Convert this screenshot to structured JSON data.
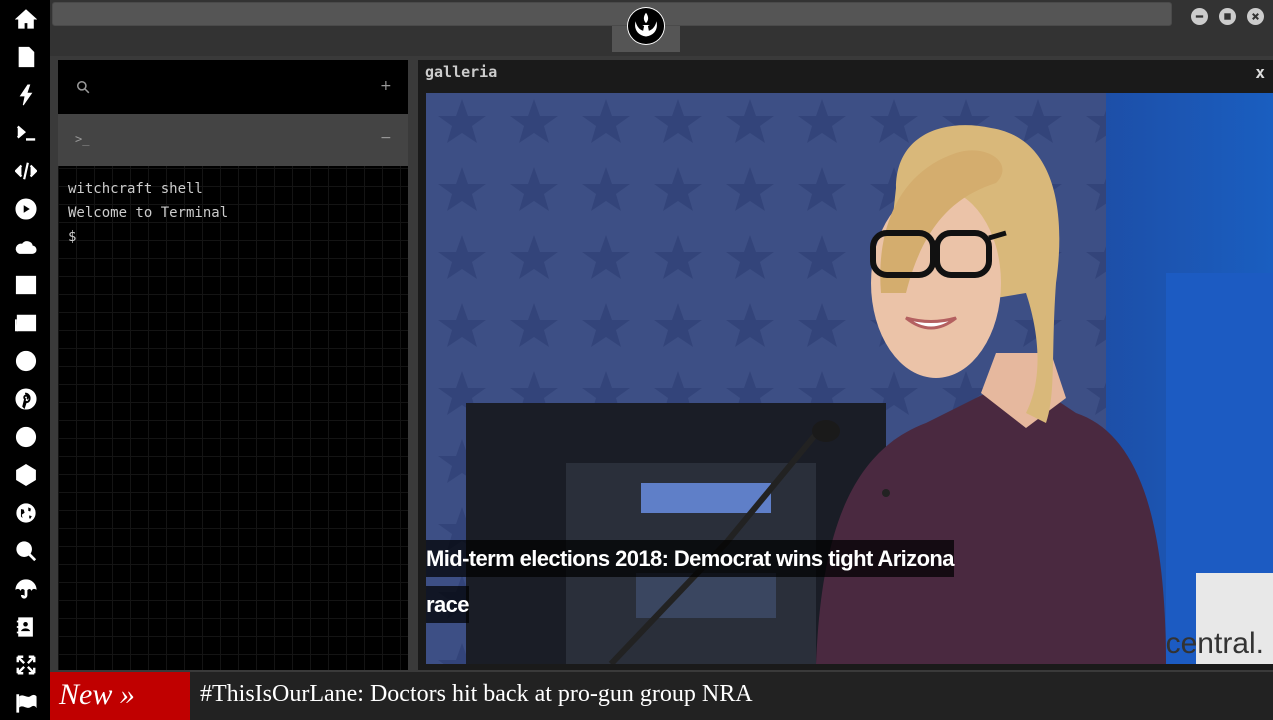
{
  "sidebar": {
    "items": [
      {
        "icon": "home-icon"
      },
      {
        "icon": "document-icon"
      },
      {
        "icon": "lightning-icon"
      },
      {
        "icon": "terminal-icon"
      },
      {
        "icon": "code-icon"
      },
      {
        "icon": "play-icon"
      },
      {
        "icon": "cloud-icon"
      },
      {
        "icon": "image-icon"
      },
      {
        "icon": "newspaper-icon"
      },
      {
        "icon": "wordpress-icon"
      },
      {
        "icon": "pinterest-icon"
      },
      {
        "icon": "galactic-empire-icon"
      },
      {
        "icon": "geodesic-icon"
      },
      {
        "icon": "globe-icon"
      },
      {
        "icon": "search-icon"
      },
      {
        "icon": "umbrella-icon"
      },
      {
        "icon": "address-book-icon"
      },
      {
        "icon": "expand-icon"
      },
      {
        "icon": "flag-icon"
      }
    ]
  },
  "topbar": {
    "logo_icon": "rebel-alliance-icon"
  },
  "window_controls": {
    "minimize_icon": "minimize-icon",
    "maximize_icon": "maximize-icon",
    "close_icon": "close-icon"
  },
  "terminal": {
    "search_icon": "search-icon",
    "add_label": "+",
    "tab_prompt": ">_",
    "tab_collapse_label": "−",
    "lines": [
      "witchcraft shell",
      "Welcome to Terminal",
      "$"
    ]
  },
  "gallery": {
    "title": "galleria",
    "close_label": "x",
    "caption": "Mid-term elections 2018: Democrat wins tight Arizona race"
  },
  "ticker": {
    "badge": "New »",
    "headline": "#ThisIsOurLane: Doctors hit back at pro-gun group NRA",
    "badge_color": "#c00000"
  }
}
